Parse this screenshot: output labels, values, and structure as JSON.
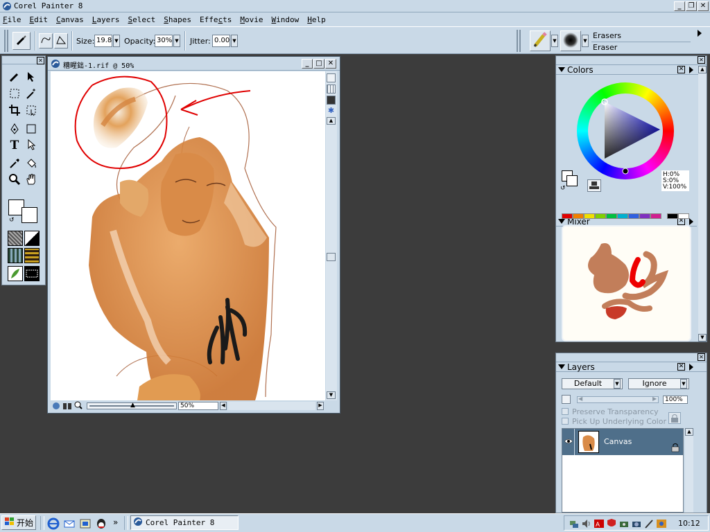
{
  "app": {
    "title": "Corel Painter 8"
  },
  "menu": [
    {
      "label": "File",
      "u": "F",
      "rest": "ile"
    },
    {
      "label": "Edit",
      "u": "E",
      "rest": "dit"
    },
    {
      "label": "Canvas",
      "u": "C",
      "rest": "anvas"
    },
    {
      "label": "Layers",
      "u": "L",
      "rest": "ayers"
    },
    {
      "label": "Select",
      "u": "S",
      "rest": "elect"
    },
    {
      "label": "Shapes",
      "u": "S",
      "rest": "hapes"
    },
    {
      "label": "Effects",
      "pre": "Effe",
      "u": "c",
      "rest": "ts"
    },
    {
      "label": "Movie",
      "u": "M",
      "rest": "ovie"
    },
    {
      "label": "Window",
      "u": "W",
      "rest": "indow"
    },
    {
      "label": "Help",
      "u": "H",
      "rest": "elp"
    }
  ],
  "propbar": {
    "size_label": "Size:",
    "size_value": "19.8",
    "opacity_label": "Opacity:",
    "opacity_value": "30%",
    "jitter_label": "Jitter:",
    "jitter_value": "0.00",
    "brush_category": "Erasers",
    "brush_variant": "Eraser"
  },
  "document": {
    "title": "糟睲鈯-1.rif @ 50%",
    "zoom": "50%"
  },
  "colors": {
    "title": "Colors",
    "h": "H:0%",
    "s": "S:0%",
    "v": "V:100%"
  },
  "mixer": {
    "title": "Mixer",
    "swatches": [
      "#e00000",
      "#f08000",
      "#f0e000",
      "#80d000",
      "#00c040",
      "#00b0d0",
      "#3060e0",
      "#8030c0",
      "#d02090",
      "#ffffff",
      "#000000",
      "#ffffff"
    ]
  },
  "layers": {
    "title": "Layers",
    "composite_method": "Default",
    "depth": "Ignore",
    "opacity": "100%",
    "preserve_transparency": "Preserve Transparency",
    "pick_up_color": "Pick Up Underlying Color",
    "items": [
      {
        "name": "Canvas"
      }
    ]
  },
  "taskbar": {
    "start_label": "开始",
    "window_label": "Corel Painter 8",
    "more": "»",
    "clock": "10:12"
  }
}
